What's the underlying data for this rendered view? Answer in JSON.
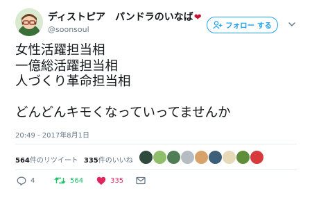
{
  "user": {
    "display_name": "ディストピア　パンドラのいなば",
    "username": "@soonsoul"
  },
  "follow_button": {
    "label": "フォロー する"
  },
  "tweet": {
    "lines": [
      "女性活躍担当相",
      "一億総活躍担当相",
      "人づくり革命担当相",
      "",
      "どんどんキモくなっていってませんか"
    ],
    "timestamp": "20:49 - 2017年8月1日"
  },
  "stats": {
    "retweet_count": "564",
    "retweet_label": "件のリツイート",
    "like_count": "335",
    "like_label": "件のいいね"
  },
  "actions": {
    "reply_count": "4",
    "retweet_count": "564",
    "like_count": "335"
  },
  "colors": {
    "accent": "#1da1f2",
    "retweet": "#17bf63",
    "like": "#e0245e",
    "muted": "#657786"
  }
}
